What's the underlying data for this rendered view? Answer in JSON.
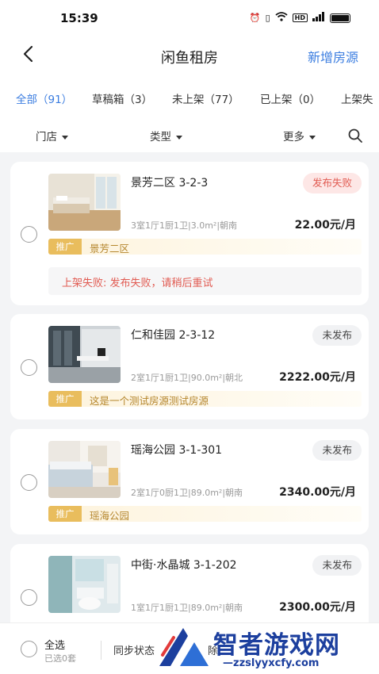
{
  "status_bar": {
    "time": "15:39"
  },
  "navbar": {
    "title": "闲鱼租房",
    "add_label": "新增房源"
  },
  "tabs": [
    {
      "label": "全部（91）",
      "active": true
    },
    {
      "label": "草稿箱（3）",
      "active": false
    },
    {
      "label": "未上架（77）",
      "active": false
    },
    {
      "label": "已上架（0）",
      "active": false
    },
    {
      "label": "上架失",
      "active": false
    }
  ],
  "filters": {
    "store": "门店",
    "type": "类型",
    "more": "更多"
  },
  "listings": [
    {
      "name": "景芳二区 3-2-3",
      "status": "发布失败",
      "status_kind": "fail",
      "specs": "3室1厅1厨1卫|3.0m²|朝南",
      "price": "22.00元/月",
      "promo_tag": "推广",
      "promo_text": "景芳二区",
      "error": "上架失败: 发布失败，请稍后重试"
    },
    {
      "name": "仁和佳园 2-3-12",
      "status": "未发布",
      "status_kind": "pending",
      "specs": "2室1厅1厨1卫|90.0m²|朝北",
      "price": "2222.00元/月",
      "promo_tag": "推广",
      "promo_text": "这是一个测试房源测试房源"
    },
    {
      "name": "瑶海公园 3-1-301",
      "status": "未发布",
      "status_kind": "pending",
      "specs": "2室1厅0厨1卫|89.0m²|朝南",
      "price": "2340.00元/月",
      "promo_tag": "推广",
      "promo_text": "瑶海公园"
    },
    {
      "name": "中街·水晶城 3-1-202",
      "status": "未发布",
      "status_kind": "pending",
      "specs": "1室1厅1厨1卫|89.0m²|朝南",
      "price": "2300.00元/月"
    }
  ],
  "bottom_bar": {
    "select_all": "全选",
    "selected": "已选0套",
    "sync": "同步状态",
    "delete": "除"
  },
  "watermark": {
    "text": "智者游戏网",
    "url": "—zzslyyxcfy.com"
  },
  "colors": {
    "accent": "#3b7de0",
    "fail": "#e15b52",
    "promo": "#e9bd5d"
  }
}
